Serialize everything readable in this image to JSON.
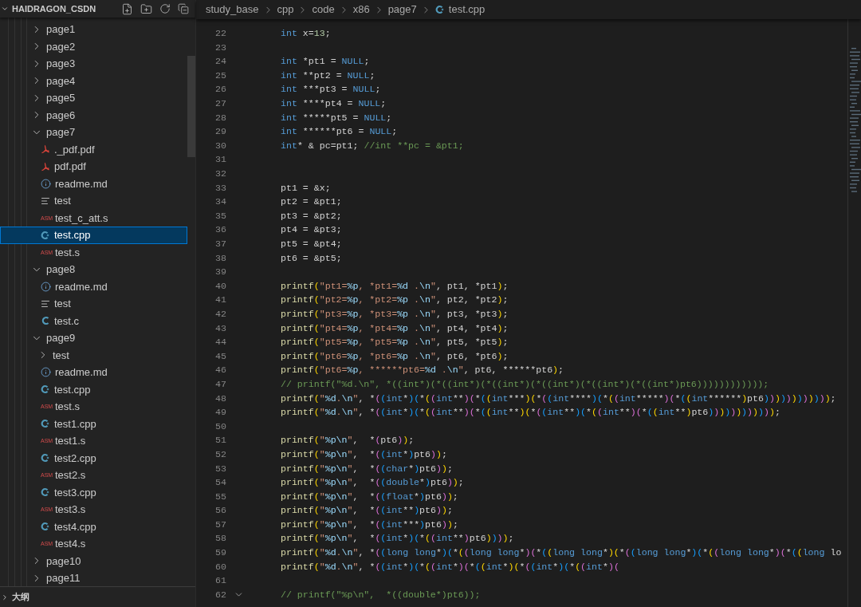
{
  "explorer": {
    "title": "HAIDRAGON_CSDN",
    "expanded": true,
    "tree": [
      {
        "label": "page1",
        "kind": "folder",
        "expanded": false,
        "selected": false
      },
      {
        "label": "page2",
        "kind": "folder",
        "expanded": false,
        "selected": false
      },
      {
        "label": "page3",
        "kind": "folder",
        "expanded": false,
        "selected": false
      },
      {
        "label": "page4",
        "kind": "folder",
        "expanded": false,
        "selected": false
      },
      {
        "label": "page5",
        "kind": "folder",
        "expanded": false,
        "selected": false
      },
      {
        "label": "page6",
        "kind": "folder",
        "expanded": false,
        "selected": false
      },
      {
        "label": "page7",
        "kind": "folder",
        "expanded": true,
        "selected": false,
        "children": [
          {
            "label": "._pdf.pdf",
            "kind": "pdf",
            "selected": false
          },
          {
            "label": "pdf.pdf",
            "kind": "pdf",
            "selected": false
          },
          {
            "label": "readme.md",
            "kind": "info",
            "selected": false
          },
          {
            "label": "test",
            "kind": "text",
            "selected": false
          },
          {
            "label": "test_c_att.s",
            "kind": "asm",
            "icon_text": "ASM",
            "selected": false
          },
          {
            "label": "test.cpp",
            "kind": "cpp",
            "selected": true
          },
          {
            "label": "test.s",
            "kind": "asm",
            "icon_text": "ASM",
            "selected": false
          }
        ]
      },
      {
        "label": "page8",
        "kind": "folder",
        "expanded": true,
        "selected": false,
        "children": [
          {
            "label": "readme.md",
            "kind": "info",
            "selected": false
          },
          {
            "label": "test",
            "kind": "text",
            "selected": false
          },
          {
            "label": "test.c",
            "kind": "c",
            "selected": false
          }
        ]
      },
      {
        "label": "page9",
        "kind": "folder",
        "expanded": true,
        "selected": false,
        "children": [
          {
            "label": "test",
            "kind": "folder",
            "expanded": false,
            "selected": false
          },
          {
            "label": "readme.md",
            "kind": "info",
            "selected": false
          },
          {
            "label": "test.cpp",
            "kind": "cpp",
            "selected": false
          },
          {
            "label": "test.s",
            "kind": "asm",
            "icon_text": "ASM",
            "selected": false
          },
          {
            "label": "test1.cpp",
            "kind": "cpp",
            "selected": false
          },
          {
            "label": "test1.s",
            "kind": "asm",
            "icon_text": "ASM",
            "selected": false
          },
          {
            "label": "test2.cpp",
            "kind": "cpp",
            "selected": false
          },
          {
            "label": "test2.s",
            "kind": "asm",
            "icon_text": "ASM",
            "selected": false
          },
          {
            "label": "test3.cpp",
            "kind": "cpp",
            "selected": false
          },
          {
            "label": "test3.s",
            "kind": "asm",
            "icon_text": "ASM",
            "selected": false
          },
          {
            "label": "test4.cpp",
            "kind": "cpp",
            "selected": false
          },
          {
            "label": "test4.s",
            "kind": "asm",
            "icon_text": "ASM",
            "selected": false
          }
        ]
      },
      {
        "label": "page10",
        "kind": "folder",
        "expanded": false,
        "selected": false
      },
      {
        "label": "page11",
        "kind": "folder",
        "expanded": false,
        "selected": false
      }
    ]
  },
  "outline": {
    "title": "大纲",
    "expanded": false
  },
  "breadcrumb": [
    {
      "label": "study_base",
      "kind": "folder"
    },
    {
      "label": "cpp",
      "kind": "folder"
    },
    {
      "label": "code",
      "kind": "folder"
    },
    {
      "label": "x86",
      "kind": "folder"
    },
    {
      "label": "page7",
      "kind": "folder"
    },
    {
      "label": "test.cpp",
      "kind": "cpp"
    }
  ],
  "lines": [
    {
      "n": "22",
      "code": "int x=13;",
      "fold": false
    },
    {
      "n": "23",
      "fold": false
    },
    {
      "n": "24",
      "code": "int *pt1 = NULL;",
      "fold": false
    },
    {
      "n": "25",
      "code": "int **pt2 = NULL;",
      "fold": false
    },
    {
      "n": "26",
      "code": "int ***pt3 = NULL;",
      "fold": false
    },
    {
      "n": "27",
      "code": "int ****pt4 = NULL;",
      "fold": false
    },
    {
      "n": "28",
      "code": "int *****pt5 = NULL;",
      "fold": false
    },
    {
      "n": "29",
      "code": "int ******pt6 = NULL;",
      "fold": false
    },
    {
      "n": "30",
      "code": "int* & pc=pt1; //int **pc = &pt1;",
      "fold": false
    },
    {
      "n": "31",
      "fold": false
    },
    {
      "n": "32",
      "fold": false
    },
    {
      "n": "33",
      "code": "pt1 = &x;",
      "fold": false
    },
    {
      "n": "34",
      "code": "pt2 = &pt1;",
      "fold": false
    },
    {
      "n": "35",
      "code": "pt3 = &pt2;",
      "fold": false
    },
    {
      "n": "36",
      "code": "pt4 = &pt3;",
      "fold": false
    },
    {
      "n": "37",
      "code": "pt5 = &pt4;",
      "fold": false
    },
    {
      "n": "38",
      "code": "pt6 = &pt5;",
      "fold": false
    },
    {
      "n": "39",
      "fold": false
    },
    {
      "n": "40",
      "code": "printf(\"pt1=%p, *pt1=%d .\\n\", pt1, *pt1);",
      "fold": false
    },
    {
      "n": "41",
      "code": "printf(\"pt2=%p, *pt2=%p .\\n\", pt2, *pt2);",
      "fold": false
    },
    {
      "n": "42",
      "code": "printf(\"pt3=%p, *pt3=%p .\\n\", pt3, *pt3);",
      "fold": false
    },
    {
      "n": "43",
      "code": "printf(\"pt4=%p, *pt4=%p .\\n\", pt4, *pt4);",
      "fold": false
    },
    {
      "n": "44",
      "code": "printf(\"pt5=%p, *pt5=%p .\\n\", pt5, *pt5);",
      "fold": false
    },
    {
      "n": "45",
      "code": "printf(\"pt6=%p, *pt6=%p .\\n\", pt6, *pt6);",
      "fold": false
    },
    {
      "n": "46",
      "code": "printf(\"pt6=%p, ******pt6=%d .\\n\", pt6, ******pt6);",
      "fold": false
    },
    {
      "n": "47",
      "code": "// printf(\"%d.\\n\", *((int*)(*((int*)(*((int*)(*((int*)(*((int*)(*((int*)pt6))))))))))));",
      "fold": false
    },
    {
      "n": "48",
      "code": "printf(\"%d.\\n\", *((int*)(*((int**)(*((int***)(*((int****)(*((int*****)(*((int******)pt6))))))))))));",
      "fold": false
    },
    {
      "n": "49",
      "code": "printf(\"%d.\\n\", *((int*)(*((int**)(*((int**)(*((int**)(*((int**)(*((int**)pt6))))))))))));",
      "fold": false
    },
    {
      "n": "50",
      "fold": false
    },
    {
      "n": "51",
      "code": "printf(\"%p\\n\",  *(pt6));",
      "fold": false
    },
    {
      "n": "52",
      "code": "printf(\"%p\\n\",  *((int*)pt6));",
      "fold": false
    },
    {
      "n": "53",
      "code": "printf(\"%p\\n\",  *((char*)pt6));",
      "fold": false
    },
    {
      "n": "54",
      "code": "printf(\"%p\\n\",  *((double*)pt6));",
      "fold": false
    },
    {
      "n": "55",
      "code": "printf(\"%p\\n\",  *((float*)pt6));",
      "fold": false
    },
    {
      "n": "56",
      "code": "printf(\"%p\\n\",  *((int**)pt6));",
      "fold": false
    },
    {
      "n": "57",
      "code": "printf(\"%p\\n\",  *((int***)pt6));",
      "fold": false
    },
    {
      "n": "58",
      "code": "printf(\"%p\\n\",  *((int*)(*((int**)pt6))));",
      "fold": false
    },
    {
      "n": "59",
      "code": "printf(\"%d.\\n\", *((long long*)(*((long long*)(*((long long*)(*((long long*)(*((long long*)(*((long lo",
      "fold": false
    },
    {
      "n": "60",
      "code": "printf(\"%d.\\n\", *((int*)(*((int*)(*((int*)(*((int*)(*((int*)(",
      "fold": false
    },
    {
      "n": "61",
      "fold": false
    },
    {
      "n": "62",
      "code": "// printf(\"%p\\n\",  *((double*)pt6));",
      "fold": true
    }
  ]
}
